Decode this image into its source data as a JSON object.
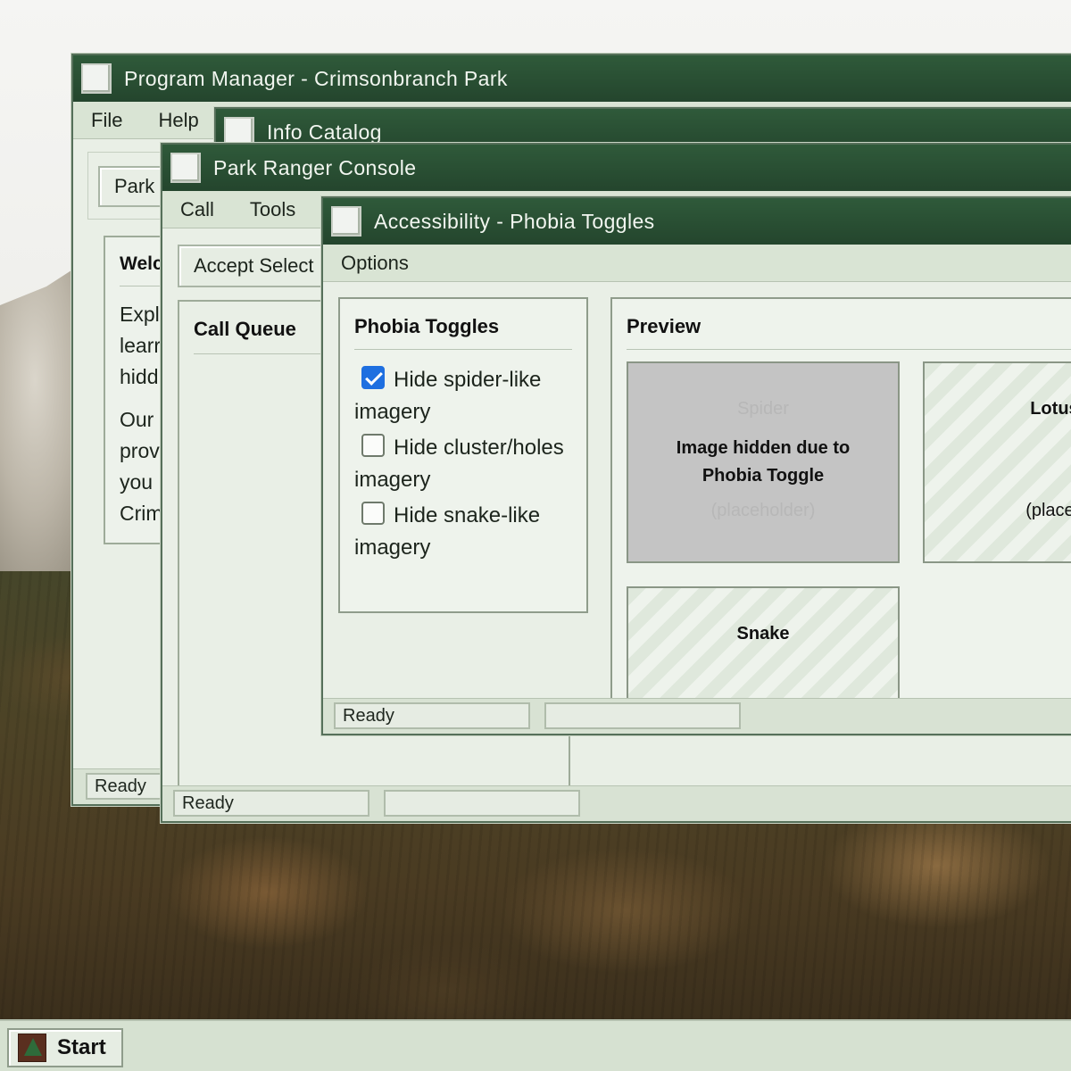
{
  "program_manager": {
    "title": "Program Manager - Crimsonbranch Park",
    "menu": [
      "File",
      "Help"
    ],
    "toolbar_button": "Park",
    "panel_heading": "Welc",
    "panel_text": [
      "Expl",
      "learr",
      "hidd",
      "Our",
      "prov",
      "you",
      "Crim"
    ],
    "status": "Ready"
  },
  "info_catalog": {
    "title": "Info Catalog"
  },
  "ranger_console": {
    "title": "Park Ranger Console",
    "menu": [
      "Call",
      "Tools"
    ],
    "accept_button": "Accept Select",
    "call_queue_title": "Call Queue",
    "status": "Ready",
    "status2": ""
  },
  "accessibility": {
    "title": "Accessibility - Phobia Toggles",
    "menu": [
      "Options"
    ],
    "toggles_title": "Phobia Toggles",
    "toggles": [
      {
        "label": "Hide spider-like imagery",
        "checked": true
      },
      {
        "label": "Hide cluster/holes imagery",
        "checked": false
      },
      {
        "label": "Hide snake-like imagery",
        "checked": false
      }
    ],
    "preview_title": "Preview",
    "tiles": [
      {
        "label": "Spider",
        "hidden_message": "Image hidden due to Phobia Toggle",
        "placeholder": "(placeholder)",
        "hidden": true
      },
      {
        "label": "Lotus I",
        "placeholder": "(placehc",
        "hidden": false
      },
      {
        "label": "Snake",
        "placeholder": "",
        "hidden": false
      }
    ],
    "status": "Ready",
    "status2": ""
  },
  "taskbar": {
    "start_label": "Start"
  }
}
